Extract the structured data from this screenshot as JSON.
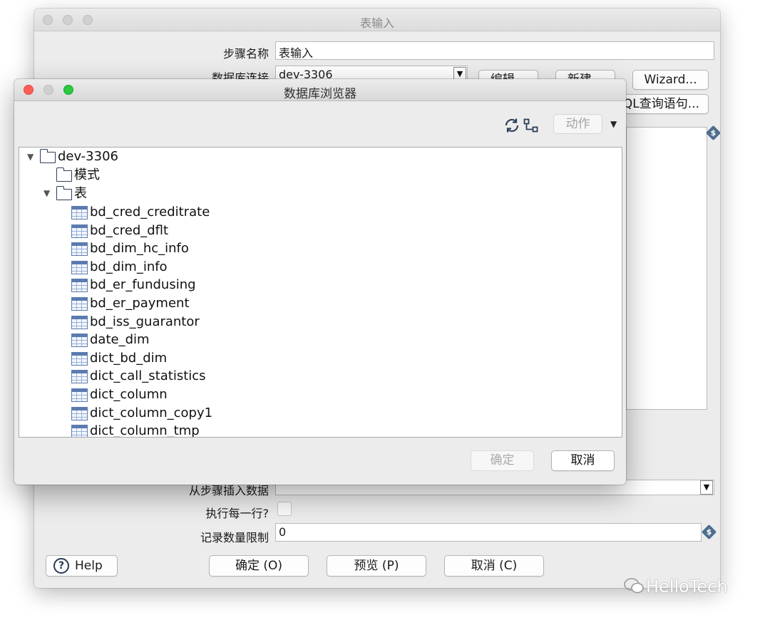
{
  "table_input_dialog": {
    "title": "表输入",
    "step_name_label": "步骤名称",
    "step_name_value": "表输入",
    "db_connection_label": "数据库连接",
    "db_connection_value": "dev-3306",
    "edit_button": "编辑...",
    "new_button": "新建...",
    "wizard_button": "Wizard...",
    "get_sql_button": "获取SQL查询语句...",
    "insert_from_step_label": "从步骤插入数据",
    "insert_from_step_value": "",
    "execute_each_row_label": "执行每一行?",
    "record_limit_label": "记录数量限制",
    "record_limit_value": "0",
    "help_button": "Help",
    "ok_button": "确定 (O)",
    "preview_button": "预览 (P)",
    "cancel_button": "取消 (C)"
  },
  "db_browser": {
    "title": "数据库浏览器",
    "action_button": "动作",
    "tree": {
      "root": "dev-3306",
      "schemas": "模式",
      "tables_folder": "表",
      "tables": [
        "bd_cred_creditrate",
        "bd_cred_dflt",
        "bd_dim_hc_info",
        "bd_dim_info",
        "bd_er_fundusing",
        "bd_er_payment",
        "bd_iss_guarantor",
        "date_dim",
        "dict_bd_dim",
        "dict_call_statistics",
        "dict_column",
        "dict_column_copy1",
        "dict_column_tmp"
      ]
    },
    "ok_button": "确定",
    "cancel_button": "取消"
  },
  "watermark": "HelloTech",
  "icons": [
    "refresh-icon",
    "structure-icon",
    "dropdown-arrow-icon",
    "variable-icon",
    "help-icon",
    "folder-icon",
    "table-icon",
    "wechat-icon"
  ],
  "colors": {
    "close_button": "#fe5f57",
    "zoom_button": "#2bc840",
    "variable_icon": "#4d6e8c",
    "table_icon": "#5b7bb0"
  }
}
